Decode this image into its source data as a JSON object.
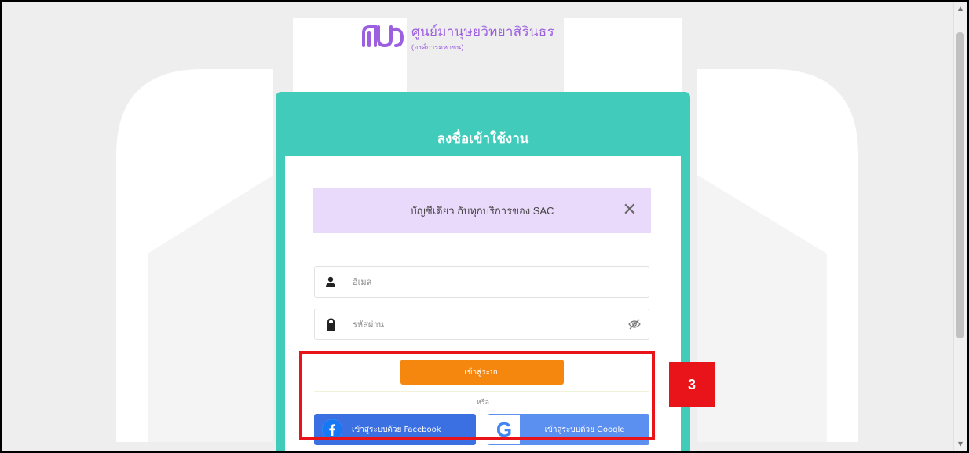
{
  "brand": {
    "logo_text": "ศูนย์มานุษยวิทยาสิรินธร",
    "logo_subtext": "(องค์การมหาชน)"
  },
  "login": {
    "title": "ลงชื่อเข้าใช้งาน",
    "notice": "บัญชีเดียว กับทุกบริการของ SAC",
    "email_placeholder": "อีเมล",
    "password_placeholder": "รหัสผ่าน",
    "submit_label": "เข้าสู่ระบบ",
    "or_label": "หรือ",
    "facebook_label": "เข้าสู่ระบบด้วย Facebook",
    "google_label": "เข้าสู่ระบบด้วย Google",
    "google_glyph": "G"
  },
  "annotation": {
    "step_number": "3",
    "color": "#e8141a"
  },
  "colors": {
    "card_header": "#40cbbb",
    "notice_bg": "#e9d9fb",
    "submit": "#f5870f",
    "facebook": "#3b70e3",
    "google": "#5b8ff0",
    "brand": "#9b5fe0"
  },
  "icons": {
    "email_field": "user-icon",
    "password_field": "lock-icon",
    "toggle_password": "eye-slash-icon",
    "close_notice": "close-icon",
    "facebook": "facebook-icon",
    "google": "google-icon"
  }
}
